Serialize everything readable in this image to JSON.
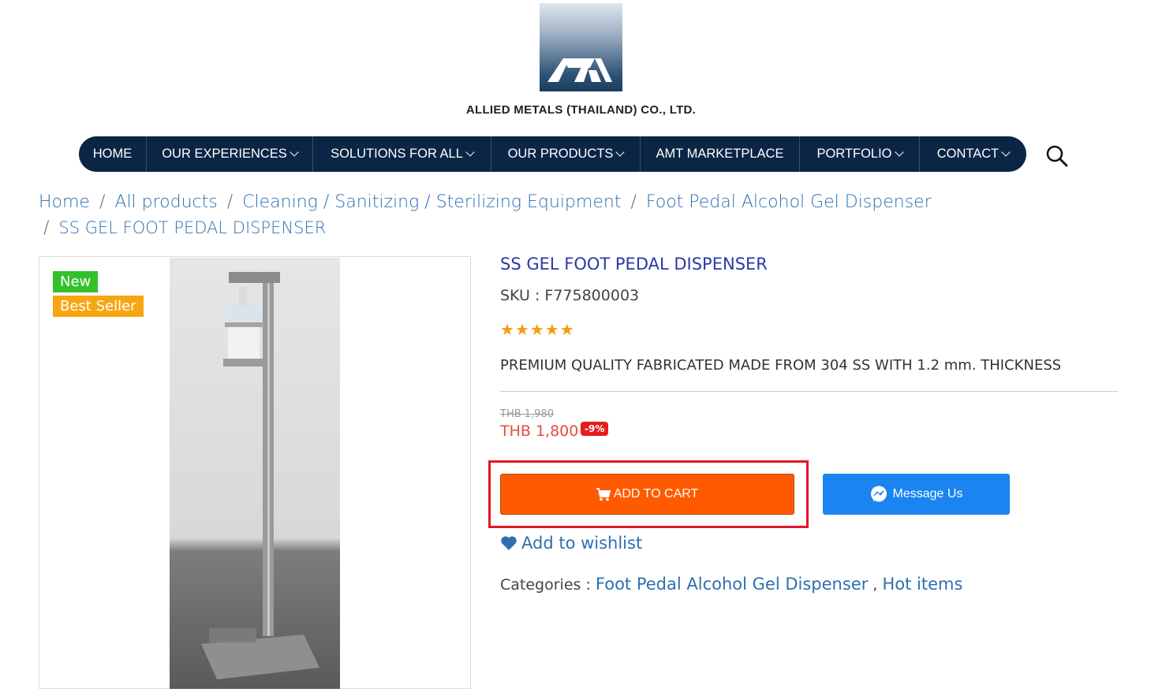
{
  "header": {
    "logo_text": "AM",
    "company_name": "ALLIED METALS (THAILAND) CO., LTD."
  },
  "nav": {
    "items": [
      {
        "label": "HOME",
        "has_dropdown": false
      },
      {
        "label": "OUR EXPERIENCES",
        "has_dropdown": true
      },
      {
        "label": "SOLUTIONS FOR ALL",
        "has_dropdown": true
      },
      {
        "label": "OUR PRODUCTS",
        "has_dropdown": true
      },
      {
        "label": "AMT MARKETPLACE",
        "has_dropdown": false
      },
      {
        "label": "PORTFOLIO",
        "has_dropdown": true
      },
      {
        "label": "CONTACT",
        "has_dropdown": true
      }
    ],
    "search_icon": "search-icon"
  },
  "breadcrumb": {
    "items": [
      "Home",
      "All products",
      "Cleaning / Sanitizing / Sterilizing Equipment",
      "Foot Pedal Alcohol Gel Dispenser"
    ],
    "current": "SS GEL FOOT PEDAL DISPENSER",
    "separator": "/"
  },
  "product": {
    "badges": {
      "new": "New",
      "best_seller": "Best Seller"
    },
    "title": "SS GEL FOOT PEDAL DISPENSER",
    "sku": "SKU : F775800003",
    "rating": 5,
    "description": "PREMIUM QUALITY FABRICATED MADE FROM 304 SS WITH 1.2 mm. THICKNESS",
    "old_price": "THB 1,980",
    "price": "THB 1,800",
    "discount": "-9%",
    "add_to_cart": "ADD TO CART",
    "message_us": "Message Us",
    "wishlist": "Add to wishlist",
    "categories_label": "Categories :",
    "categories": [
      "Foot Pedal Alcohol Gel Dispenser",
      "Hot items"
    ]
  },
  "colors": {
    "nav_bg": "#0b2545",
    "add_to_cart": "#ff5a00",
    "message_us": "#1a84f0",
    "highlight_frame": "#e3152b",
    "badge_new": "#33c12b",
    "badge_best": "#f7a612",
    "price": "#e74c3c"
  }
}
